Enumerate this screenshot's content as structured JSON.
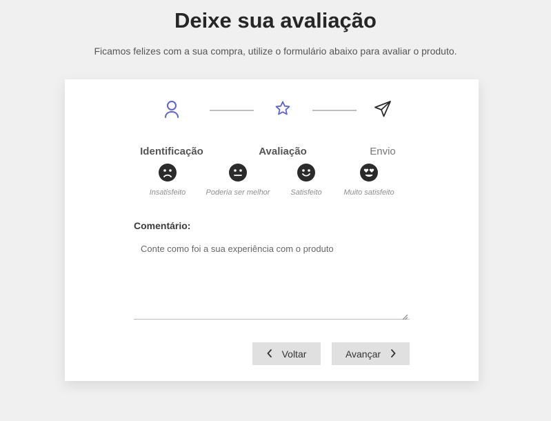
{
  "header": {
    "title": "Deixe sua avaliação",
    "subtitle": "Ficamos felizes com a sua compra, utilize o formulário abaixo para avaliar o produto."
  },
  "steps": [
    {
      "label": "Identificação",
      "icon": "user-icon",
      "state": "done",
      "color": "#5b63d6"
    },
    {
      "label": "Avaliação",
      "icon": "star-icon",
      "state": "active",
      "color": "#5b63d6"
    },
    {
      "label": "Envio",
      "icon": "send-icon",
      "state": "pending",
      "color": "#2b2b2b"
    }
  ],
  "ratings": [
    {
      "label": "Insatisfeito",
      "icon": "sad-face-icon"
    },
    {
      "label": "Poderia ser melhor",
      "icon": "neutral-face-icon"
    },
    {
      "label": "Satisfeito",
      "icon": "smile-face-icon"
    },
    {
      "label": "Muito satisfeito",
      "icon": "heart-eyes-face-icon"
    }
  ],
  "comment": {
    "label": "Comentário:",
    "placeholder": "Conte como foi a sua experiência com o produto",
    "value": ""
  },
  "buttons": {
    "back_label": "Voltar",
    "next_label": "Avançar"
  },
  "colors": {
    "background": "#f0f0f0",
    "card": "#ffffff",
    "accent": "#5b63d6",
    "button": "#e0e0e0"
  }
}
